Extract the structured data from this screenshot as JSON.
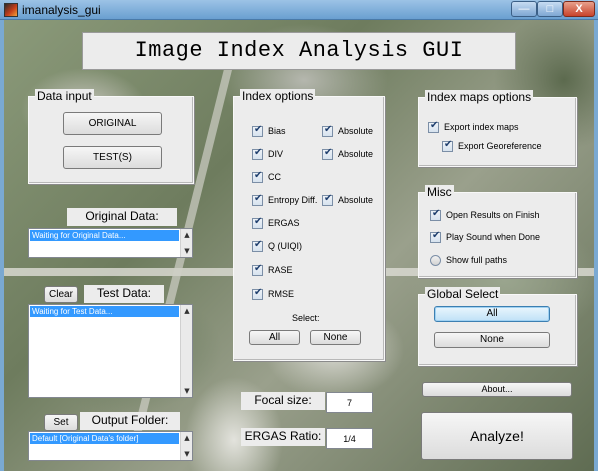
{
  "window": {
    "title": "imanalysis_gui",
    "min_label": "—",
    "max_label": "□",
    "close_label": "X"
  },
  "main_title": "Image Index Analysis GUI",
  "data_input": {
    "title": "Data input",
    "original_label": "ORIGINAL",
    "test_label": "TEST(S)"
  },
  "original_data": {
    "label": "Original Data:",
    "selected_item": "Waiting for Original Data..."
  },
  "test_data": {
    "label": "Test Data:",
    "clear_label": "Clear",
    "selected_item": "Waiting for Test Data..."
  },
  "output_folder": {
    "label": "Output Folder:",
    "set_label": "Set",
    "selected_item": "Default   [Original Data's folder]"
  },
  "index_options": {
    "title": "Index options",
    "items": [
      {
        "label": "Bias",
        "checked": true,
        "absolute": true
      },
      {
        "label": "DIV",
        "checked": true,
        "absolute": true
      },
      {
        "label": "CC",
        "checked": true
      },
      {
        "label": "Entropy Diff.",
        "checked": true,
        "absolute": true
      },
      {
        "label": "ERGAS",
        "checked": true
      },
      {
        "label": "Q (UIQI)",
        "checked": true
      },
      {
        "label": "RASE",
        "checked": true
      },
      {
        "label": "RMSE",
        "checked": true
      }
    ],
    "absolute_label": "Absolute",
    "select_label": "Select:",
    "all_label": "All",
    "none_label": "None"
  },
  "index_maps": {
    "title": "Index maps options",
    "export_index_maps": "Export index maps",
    "export_georeference": "Export Georeference"
  },
  "misc": {
    "title": "Misc",
    "open_results": "Open Results on Finish",
    "play_sound": "Play Sound when Done",
    "show_full_paths": "Show  full paths"
  },
  "global_select": {
    "title": "Global Select",
    "all_label": "All",
    "none_label": "None"
  },
  "about_label": "About...",
  "focal_size": {
    "label": "Focal size:",
    "value": "7"
  },
  "ergas_ratio": {
    "label": "ERGAS Ratio:",
    "value": "1/4"
  },
  "analyze_label": "Analyze!",
  "colors": {
    "selection": "#3399ff",
    "panel": "#ececec",
    "accent_button": "#bfe1f7"
  }
}
